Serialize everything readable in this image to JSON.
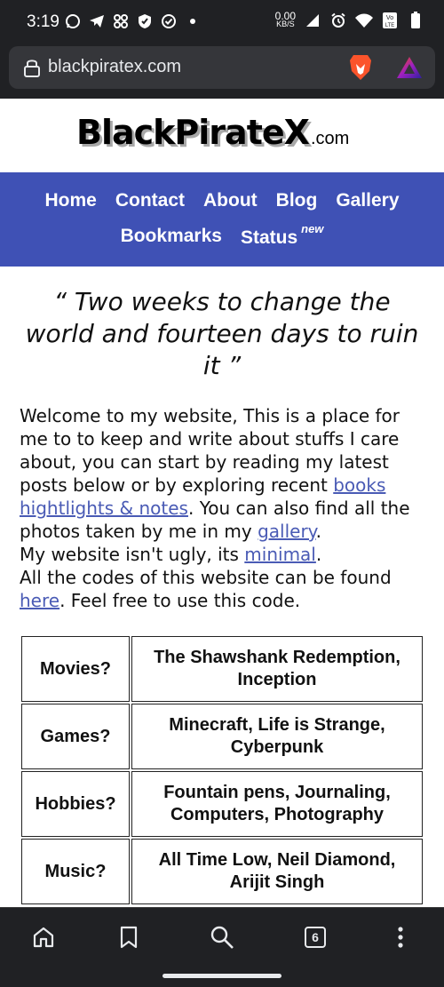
{
  "status_bar": {
    "time": "3:19",
    "speed_value": "0.00",
    "speed_unit": "KB/S",
    "icons_left": [
      "whatsapp-icon",
      "telegram-icon",
      "pinwheel-icon",
      "shield-icon",
      "check-circle-icon",
      "dot-icon"
    ],
    "icons_right": [
      "network-speed",
      "signal-icon",
      "alarm-icon",
      "wifi-icon",
      "volte-icon",
      "battery-icon"
    ]
  },
  "browser": {
    "url": "blackpiratex.com",
    "tab_count": "6"
  },
  "site": {
    "logo_main": "BlackPirateX",
    "logo_tld": ".com"
  },
  "nav": {
    "items": [
      "Home",
      "Contact",
      "About",
      "Blog",
      "Gallery",
      "Bookmarks",
      "Status"
    ],
    "status_badge": "new"
  },
  "quote": "“ Two weeks to change the world and fourteen days to ruin it ”",
  "intro": {
    "p1_a": "Welcome to my website, This is a place for me to to keep and write about stuffs I care about, you can start by reading my latest posts below or by exploring recent ",
    "link_books": "books hightlights & notes",
    "p1_b": ". You can also find all the photos taken by me in my ",
    "link_gallery": "gallery",
    "p1_c": ".",
    "p2_a": "My website isn't ugly, its ",
    "link_minimal": "minimal",
    "p2_b": ".",
    "p3_a": "All the codes of this website can be found ",
    "link_here": "here",
    "p3_b": ". Feel free to use this code."
  },
  "favorites": [
    {
      "key": "Movies?",
      "value": "The Shawshank Redemption, Inception"
    },
    {
      "key": "Games?",
      "value": "Minecraft, Life is Strange, Cyberpunk"
    },
    {
      "key": "Hobbies?",
      "value": "Fountain pens, Journaling, Computers, Photography"
    },
    {
      "key": "Music?",
      "value": "All Time Low, Neil Diamond, Arijit Singh"
    }
  ],
  "colors": {
    "nav_background": "#3f51b5",
    "link": "#4a5bb5",
    "browser_chrome": "#202124"
  }
}
